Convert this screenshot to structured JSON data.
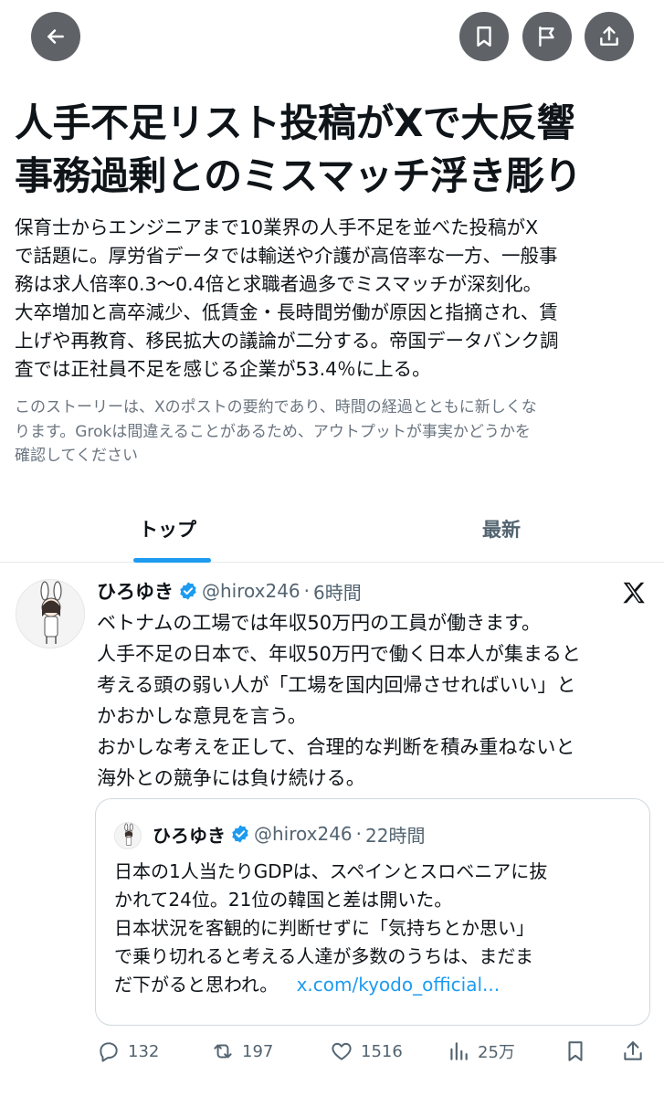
{
  "topbar": {
    "back_icon": "arrow-left-icon",
    "bookmark_icon": "bookmark-icon",
    "flag_icon": "flag-icon",
    "share_icon": "share-icon"
  },
  "story": {
    "headline_line1": "人手不足リスト投稿がXで大反響",
    "headline_line2": "事務過剰とのミスマッチ浮き彫り",
    "summary_lines": [
      "保育士からエンジニアまで10業界の人手不足を並べた投稿がX",
      "で話題に。厚労省データでは輸送や介護が高倍率な一方、一般事",
      "務は求人倍率0.3～0.4倍と求職者過多でミスマッチが深刻化。",
      "大卒増加と高卒減少、低賃金・長時間労働が原因と指摘され、賃",
      "上げや再教育、移民拡大の議論が二分する。帝国データバンク調",
      "査では正社員不足を感じる企業が53.4％に上る。"
    ],
    "disclaimer_lines": [
      "このストーリーは、Xのポストの要約であり、時間の経過とともに新しくな",
      "ります。Grokは間違えることがあるため、アウトプットが事実かどうかを",
      "確認してください"
    ]
  },
  "tabs": {
    "top": "トップ",
    "latest": "最新",
    "active": "top"
  },
  "tweet": {
    "author": "ひろゆき",
    "handle": "@hirox246",
    "separator": "·",
    "time": "6時間",
    "body_lines": [
      "ベトナムの工場では年収50万円の工員が働きます。",
      "人手不足の日本で、年収50万円で働く日本人が集まると",
      "考える頭の弱い人が「工場を国内回帰させればいい」と",
      "かおかしな意見を言う。",
      "おかしな考えを正して、合理的な判断を積み重ねないと",
      "海外との競争には負け続ける。"
    ],
    "quote": {
      "author": "ひろゆき",
      "handle": "@hirox246",
      "separator": "·",
      "time": "22時間",
      "body_lines": [
        "日本の1人当たりGDPは、スペインとスロベニアに抜",
        "かれて24位。21位の韓国と差は開いた。",
        "日本状況を客観的に判断せずに「気持ちとか思い」",
        "で乗り切れると考える人達が多数のうちは、まだま"
      ],
      "last_line_text": "だ下がると思われ。",
      "link": "x.com/kyodo_official..."
    },
    "actions": {
      "replies": "132",
      "reposts": "197",
      "likes": "1516",
      "views": "25万"
    }
  },
  "colors": {
    "accent": "#1d9bf0",
    "text": "#0f1419",
    "muted": "#536471",
    "topbar_button": "#5f6368"
  }
}
